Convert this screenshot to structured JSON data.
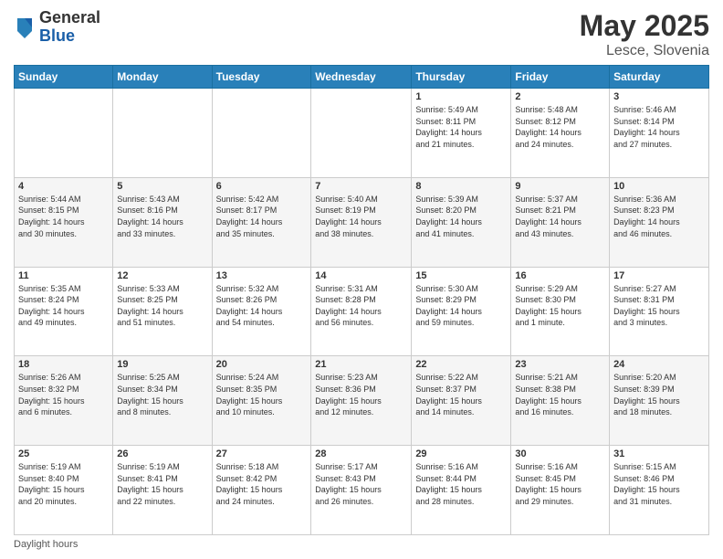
{
  "header": {
    "logo_general": "General",
    "logo_blue": "Blue",
    "title": "May 2025",
    "location": "Lesce, Slovenia"
  },
  "footer": {
    "daylight_label": "Daylight hours"
  },
  "days_of_week": [
    "Sunday",
    "Monday",
    "Tuesday",
    "Wednesday",
    "Thursday",
    "Friday",
    "Saturday"
  ],
  "weeks": [
    [
      {
        "day": "",
        "info": ""
      },
      {
        "day": "",
        "info": ""
      },
      {
        "day": "",
        "info": ""
      },
      {
        "day": "",
        "info": ""
      },
      {
        "day": "1",
        "info": "Sunrise: 5:49 AM\nSunset: 8:11 PM\nDaylight: 14 hours\nand 21 minutes."
      },
      {
        "day": "2",
        "info": "Sunrise: 5:48 AM\nSunset: 8:12 PM\nDaylight: 14 hours\nand 24 minutes."
      },
      {
        "day": "3",
        "info": "Sunrise: 5:46 AM\nSunset: 8:14 PM\nDaylight: 14 hours\nand 27 minutes."
      }
    ],
    [
      {
        "day": "4",
        "info": "Sunrise: 5:44 AM\nSunset: 8:15 PM\nDaylight: 14 hours\nand 30 minutes."
      },
      {
        "day": "5",
        "info": "Sunrise: 5:43 AM\nSunset: 8:16 PM\nDaylight: 14 hours\nand 33 minutes."
      },
      {
        "day": "6",
        "info": "Sunrise: 5:42 AM\nSunset: 8:17 PM\nDaylight: 14 hours\nand 35 minutes."
      },
      {
        "day": "7",
        "info": "Sunrise: 5:40 AM\nSunset: 8:19 PM\nDaylight: 14 hours\nand 38 minutes."
      },
      {
        "day": "8",
        "info": "Sunrise: 5:39 AM\nSunset: 8:20 PM\nDaylight: 14 hours\nand 41 minutes."
      },
      {
        "day": "9",
        "info": "Sunrise: 5:37 AM\nSunset: 8:21 PM\nDaylight: 14 hours\nand 43 minutes."
      },
      {
        "day": "10",
        "info": "Sunrise: 5:36 AM\nSunset: 8:23 PM\nDaylight: 14 hours\nand 46 minutes."
      }
    ],
    [
      {
        "day": "11",
        "info": "Sunrise: 5:35 AM\nSunset: 8:24 PM\nDaylight: 14 hours\nand 49 minutes."
      },
      {
        "day": "12",
        "info": "Sunrise: 5:33 AM\nSunset: 8:25 PM\nDaylight: 14 hours\nand 51 minutes."
      },
      {
        "day": "13",
        "info": "Sunrise: 5:32 AM\nSunset: 8:26 PM\nDaylight: 14 hours\nand 54 minutes."
      },
      {
        "day": "14",
        "info": "Sunrise: 5:31 AM\nSunset: 8:28 PM\nDaylight: 14 hours\nand 56 minutes."
      },
      {
        "day": "15",
        "info": "Sunrise: 5:30 AM\nSunset: 8:29 PM\nDaylight: 14 hours\nand 59 minutes."
      },
      {
        "day": "16",
        "info": "Sunrise: 5:29 AM\nSunset: 8:30 PM\nDaylight: 15 hours\nand 1 minute."
      },
      {
        "day": "17",
        "info": "Sunrise: 5:27 AM\nSunset: 8:31 PM\nDaylight: 15 hours\nand 3 minutes."
      }
    ],
    [
      {
        "day": "18",
        "info": "Sunrise: 5:26 AM\nSunset: 8:32 PM\nDaylight: 15 hours\nand 6 minutes."
      },
      {
        "day": "19",
        "info": "Sunrise: 5:25 AM\nSunset: 8:34 PM\nDaylight: 15 hours\nand 8 minutes."
      },
      {
        "day": "20",
        "info": "Sunrise: 5:24 AM\nSunset: 8:35 PM\nDaylight: 15 hours\nand 10 minutes."
      },
      {
        "day": "21",
        "info": "Sunrise: 5:23 AM\nSunset: 8:36 PM\nDaylight: 15 hours\nand 12 minutes."
      },
      {
        "day": "22",
        "info": "Sunrise: 5:22 AM\nSunset: 8:37 PM\nDaylight: 15 hours\nand 14 minutes."
      },
      {
        "day": "23",
        "info": "Sunrise: 5:21 AM\nSunset: 8:38 PM\nDaylight: 15 hours\nand 16 minutes."
      },
      {
        "day": "24",
        "info": "Sunrise: 5:20 AM\nSunset: 8:39 PM\nDaylight: 15 hours\nand 18 minutes."
      }
    ],
    [
      {
        "day": "25",
        "info": "Sunrise: 5:19 AM\nSunset: 8:40 PM\nDaylight: 15 hours\nand 20 minutes."
      },
      {
        "day": "26",
        "info": "Sunrise: 5:19 AM\nSunset: 8:41 PM\nDaylight: 15 hours\nand 22 minutes."
      },
      {
        "day": "27",
        "info": "Sunrise: 5:18 AM\nSunset: 8:42 PM\nDaylight: 15 hours\nand 24 minutes."
      },
      {
        "day": "28",
        "info": "Sunrise: 5:17 AM\nSunset: 8:43 PM\nDaylight: 15 hours\nand 26 minutes."
      },
      {
        "day": "29",
        "info": "Sunrise: 5:16 AM\nSunset: 8:44 PM\nDaylight: 15 hours\nand 28 minutes."
      },
      {
        "day": "30",
        "info": "Sunrise: 5:16 AM\nSunset: 8:45 PM\nDaylight: 15 hours\nand 29 minutes."
      },
      {
        "day": "31",
        "info": "Sunrise: 5:15 AM\nSunset: 8:46 PM\nDaylight: 15 hours\nand 31 minutes."
      }
    ]
  ]
}
